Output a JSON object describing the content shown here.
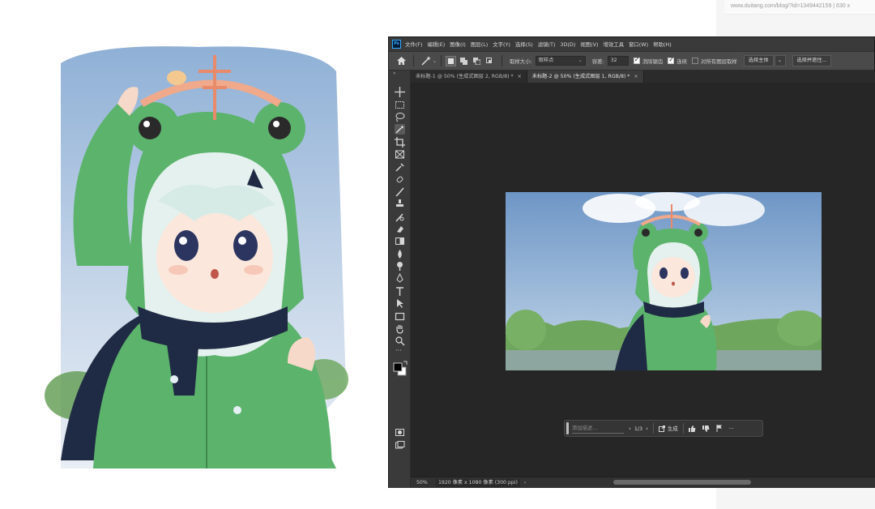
{
  "browser": {
    "url": "www.duitang.com/blog/?id=1349442159 | 630 x"
  },
  "photoshop": {
    "logo": "Ps",
    "menu": [
      "文件(F)",
      "编辑(E)",
      "图像(I)",
      "图层(L)",
      "文字(Y)",
      "选择(S)",
      "滤镜(T)",
      "3D(D)",
      "视图(V)",
      "增效工具",
      "窗口(W)",
      "帮助(H)"
    ],
    "options": {
      "sample_size_label": "取样大小:",
      "sample_size_value": "取样点",
      "tolerance_label": "容差:",
      "tolerance_value": "32",
      "antialias_label": "消除锯齿",
      "contiguous_label": "连续",
      "sample_all_label": "对所有图层取样",
      "select_subject_label": "选择主体",
      "select_and_mask_label": "选择并遮住..."
    },
    "tabs": [
      {
        "label": "未标题-1 @ 50% (生成式图层 2, RGB/8) *",
        "close": "×"
      },
      {
        "label": "未标题-2 @ 50% (生成式图层 1, RGB/8) *",
        "close": "×"
      }
    ],
    "toolbox_collapse": "»",
    "contextual_bar": {
      "placeholder": "添加描述...",
      "page_indicator": "1/3",
      "generate_label": "生成",
      "more_label": "···"
    },
    "status": {
      "zoom": "50%",
      "doc_info": "1920 像素 x 1080 像素 (300 ppi)",
      "arrow": "›"
    }
  }
}
